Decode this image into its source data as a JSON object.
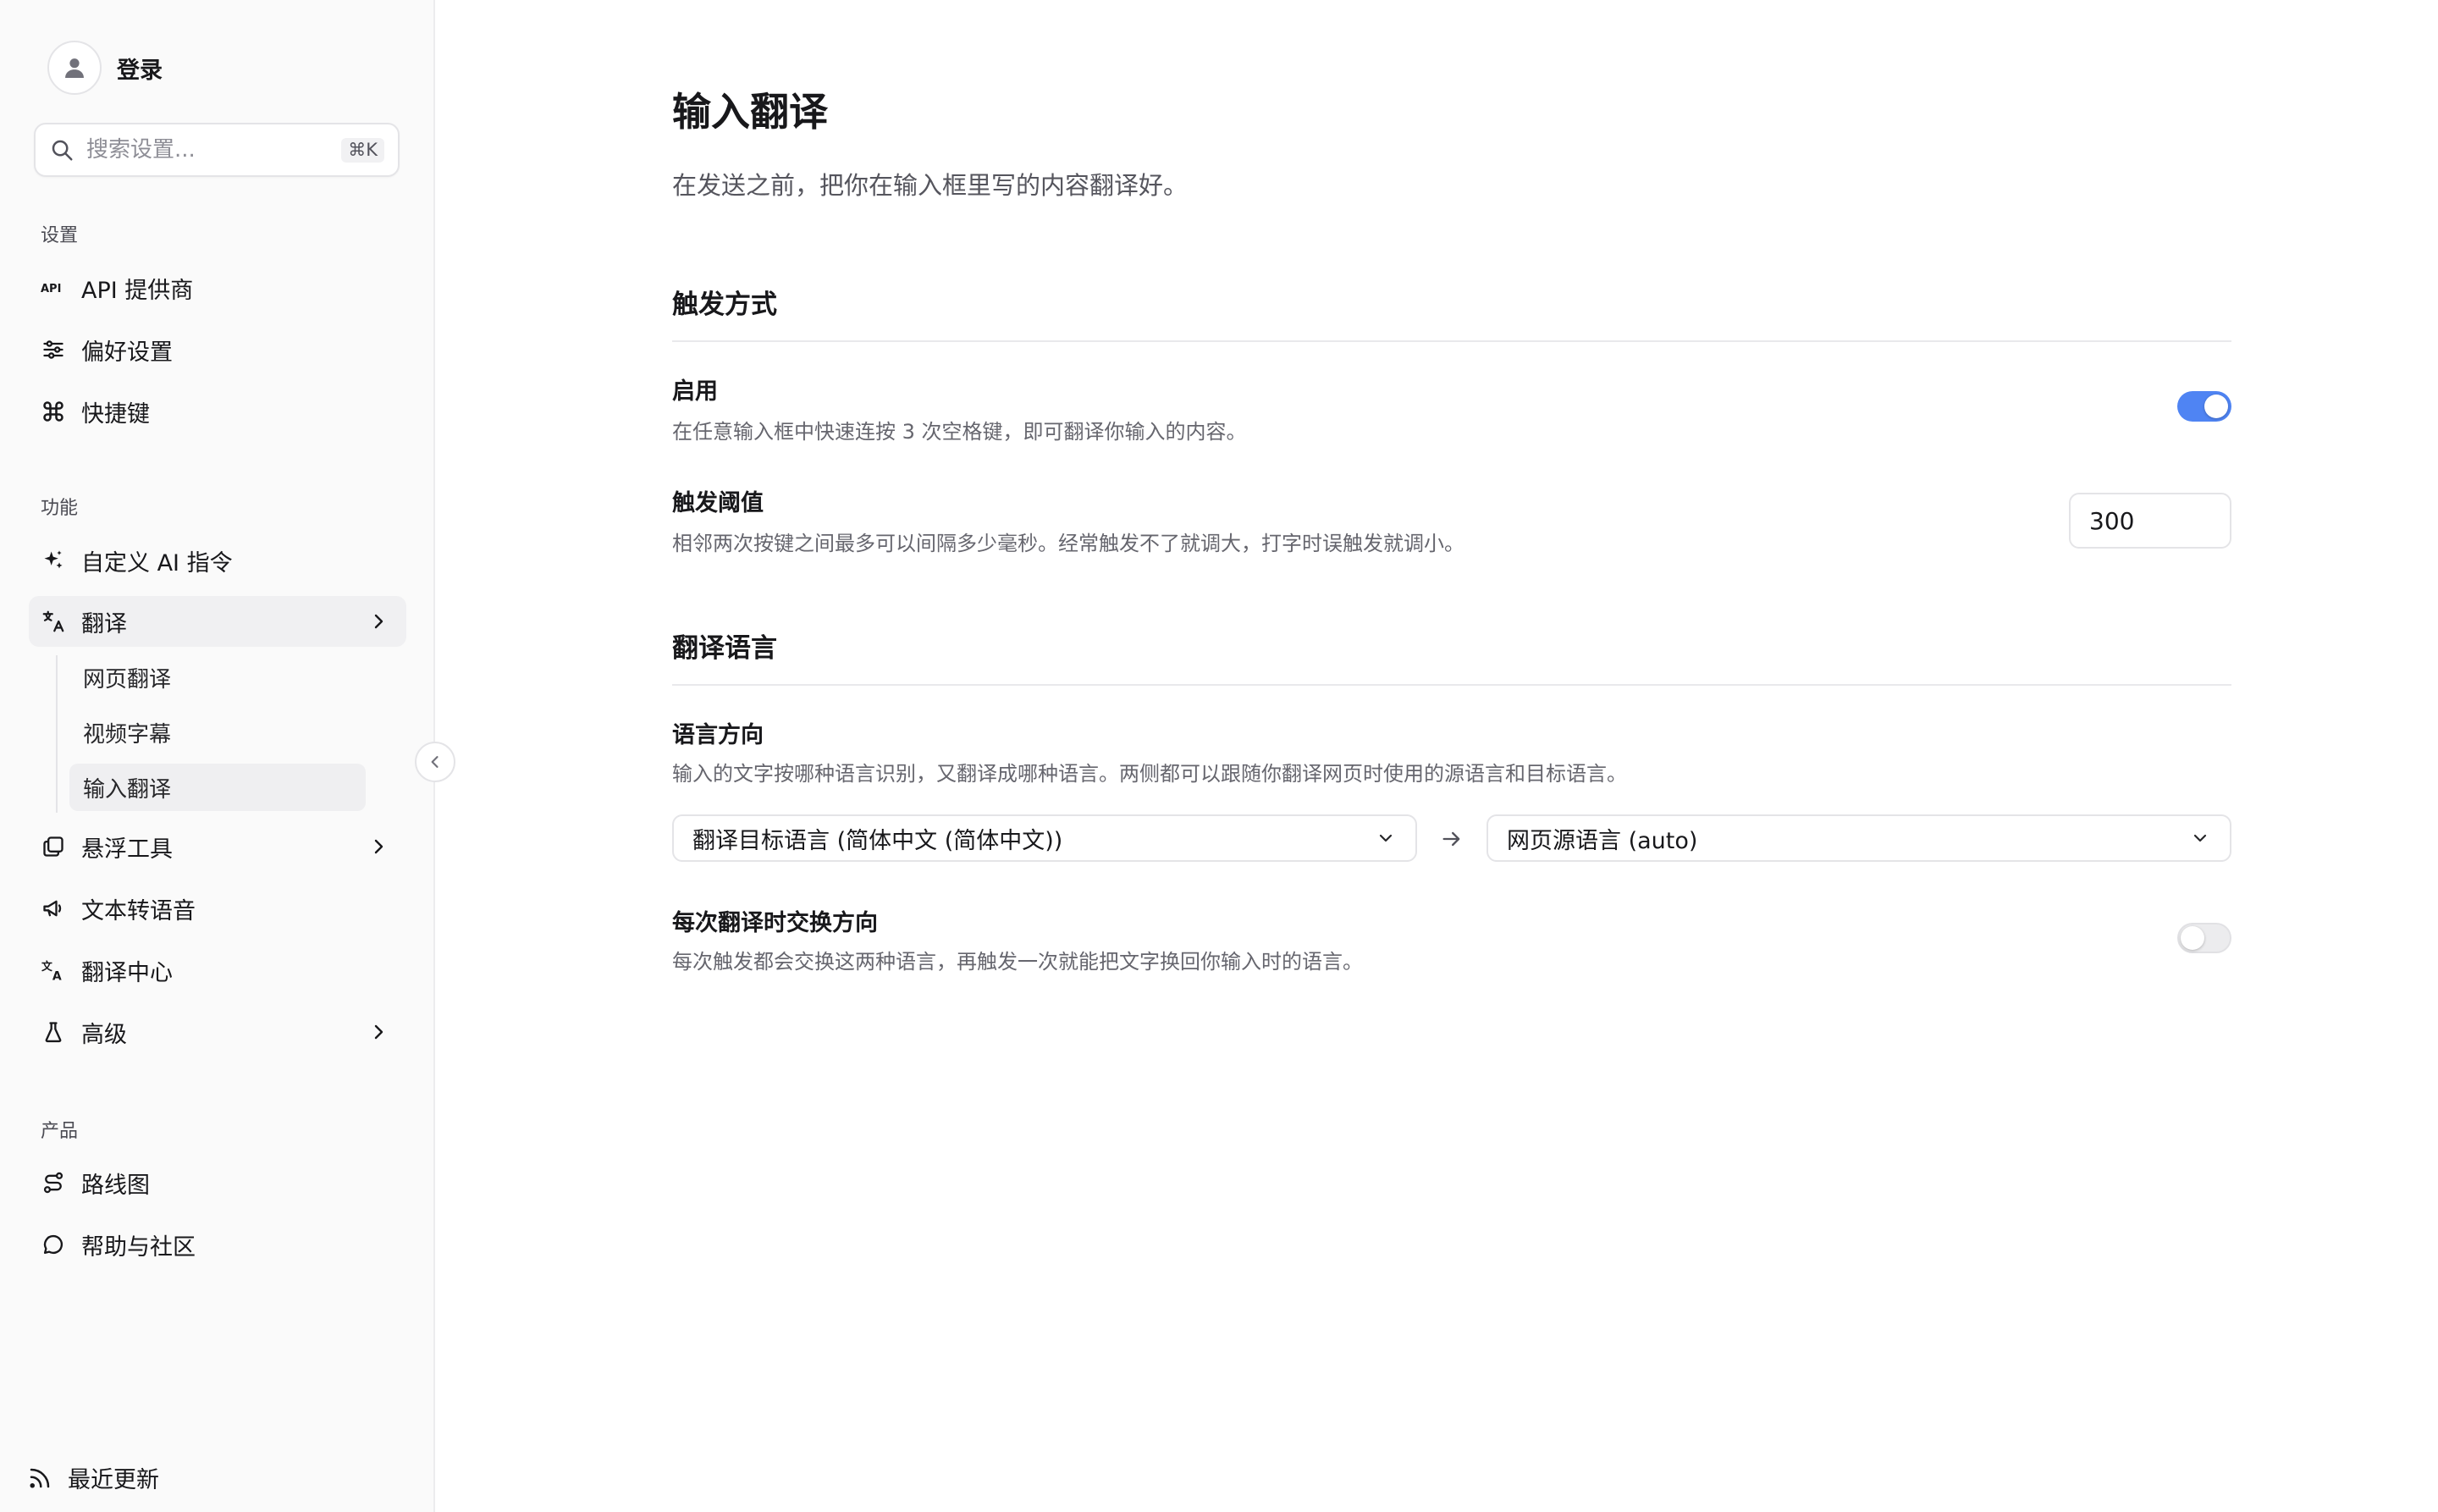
{
  "sidebar": {
    "login_label": "登录",
    "search": {
      "placeholder": "搜索设置...",
      "shortcut": "⌘K"
    },
    "sections": {
      "settings": "设置",
      "features": "功能",
      "product": "产品"
    },
    "settings_items": [
      {
        "label": "API 提供商",
        "icon": "api-icon"
      },
      {
        "label": "偏好设置",
        "icon": "sliders-icon"
      },
      {
        "label": "快捷键",
        "icon": "command-icon"
      }
    ],
    "feature_items": [
      {
        "label": "自定义 AI 指令",
        "icon": "sparkles-icon"
      },
      {
        "label": "翻译",
        "icon": "translate-icon",
        "expanded": true
      },
      {
        "label": "悬浮工具",
        "icon": "layers-icon"
      },
      {
        "label": "文本转语音",
        "icon": "megaphone-icon"
      },
      {
        "label": "翻译中心",
        "icon": "languages-icon"
      },
      {
        "label": "高级",
        "icon": "flask-icon"
      }
    ],
    "translate_sub_items": [
      {
        "label": "网页翻译"
      },
      {
        "label": "视频字幕"
      },
      {
        "label": "输入翻译",
        "active": true
      }
    ],
    "product_items": [
      {
        "label": "路线图",
        "icon": "route-icon"
      },
      {
        "label": "帮助与社区",
        "icon": "message-icon"
      }
    ],
    "recent_updates": "最近更新"
  },
  "main": {
    "title": "输入翻译",
    "description": "在发送之前，把你在输入框里写的内容翻译好。",
    "trigger": {
      "title": "触发方式",
      "enable": {
        "title": "启用",
        "desc": "在任意输入框中快速连按 3 次空格键，即可翻译你输入的内容。",
        "on": true
      },
      "threshold": {
        "title": "触发阈值",
        "desc": "相邻两次按键之间最多可以间隔多少毫秒。经常触发不了就调大，打字时误触发就调小。",
        "value": "300"
      }
    },
    "languages": {
      "title": "翻译语言",
      "direction": {
        "title": "语言方向",
        "desc": "输入的文字按哪种语言识别，又翻译成哪种语言。两侧都可以跟随你翻译网页时使用的源语言和目标语言。",
        "from": "翻译目标语言 (简体中文 (简体中文))",
        "to": "网页源语言 (auto)"
      },
      "swap": {
        "title": "每次翻译时交换方向",
        "desc": "每次触发都会交换这两种语言，再触发一次就能把文字换回你输入时的语言。",
        "on": false
      }
    }
  },
  "colors": {
    "accent": "#4f84f3",
    "sidebar_bg": "#fafafa",
    "active_bg": "#f0f0f2"
  }
}
